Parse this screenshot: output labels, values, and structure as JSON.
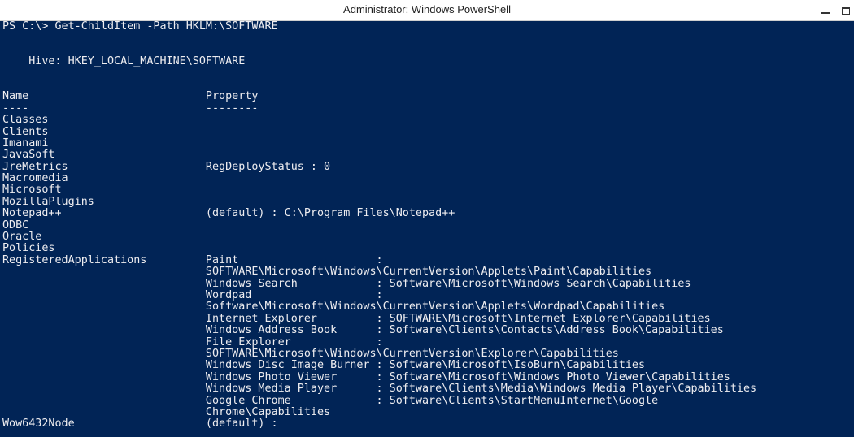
{
  "window": {
    "title": "Administrator: Windows PowerShell"
  },
  "colors": {
    "console_background": "#012456",
    "console_text": "#EEEDF0",
    "titlebar_background": "#FFFFFF"
  },
  "icons": {
    "minimize": "minimize-icon",
    "maximize": "maximize-icon"
  },
  "console": {
    "lines": [
      "PS C:\\> Get-ChildItem -Path HKLM:\\SOFTWARE",
      "",
      "",
      "    Hive: HKEY_LOCAL_MACHINE\\SOFTWARE",
      "",
      "",
      "Name                           Property",
      "----                           --------",
      "Classes",
      "Clients",
      "Imanami",
      "JavaSoft",
      "JreMetrics                     RegDeployStatus : 0",
      "Macromedia",
      "Microsoft",
      "MozillaPlugins",
      "Notepad++                      (default) : C:\\Program Files\\Notepad++",
      "ODBC",
      "Oracle",
      "Policies",
      "RegisteredApplications         Paint                     :",
      "                               SOFTWARE\\Microsoft\\Windows\\CurrentVersion\\Applets\\Paint\\Capabilities",
      "                               Windows Search            : Software\\Microsoft\\Windows Search\\Capabilities",
      "                               Wordpad                   :",
      "                               Software\\Microsoft\\Windows\\CurrentVersion\\Applets\\Wordpad\\Capabilities",
      "                               Internet Explorer         : SOFTWARE\\Microsoft\\Internet Explorer\\Capabilities",
      "                               Windows Address Book      : Software\\Clients\\Contacts\\Address Book\\Capabilities",
      "                               File Explorer             :",
      "                               SOFTWARE\\Microsoft\\Windows\\CurrentVersion\\Explorer\\Capabilities",
      "                               Windows Disc Image Burner : Software\\Microsoft\\IsoBurn\\Capabilities",
      "                               Windows Photo Viewer      : Software\\Microsoft\\Windows Photo Viewer\\Capabilities",
      "                               Windows Media Player      : Software\\Clients\\Media\\Windows Media Player\\Capabilities",
      "                               Google Chrome             : Software\\Clients\\StartMenuInternet\\Google",
      "                               Chrome\\Capabilities",
      "Wow6432Node                    (default) :"
    ]
  }
}
